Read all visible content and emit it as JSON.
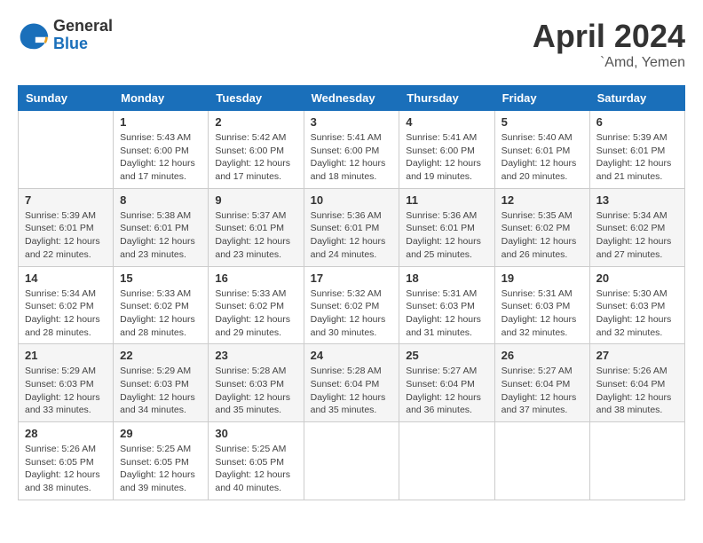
{
  "header": {
    "logo_general": "General",
    "logo_blue": "Blue",
    "month_title": "April 2024",
    "location": "`Amd, Yemen"
  },
  "weekdays": [
    "Sunday",
    "Monday",
    "Tuesday",
    "Wednesday",
    "Thursday",
    "Friday",
    "Saturday"
  ],
  "weeks": [
    [
      {
        "day": "",
        "info": ""
      },
      {
        "day": "1",
        "info": "Sunrise: 5:43 AM\nSunset: 6:00 PM\nDaylight: 12 hours\nand 17 minutes."
      },
      {
        "day": "2",
        "info": "Sunrise: 5:42 AM\nSunset: 6:00 PM\nDaylight: 12 hours\nand 17 minutes."
      },
      {
        "day": "3",
        "info": "Sunrise: 5:41 AM\nSunset: 6:00 PM\nDaylight: 12 hours\nand 18 minutes."
      },
      {
        "day": "4",
        "info": "Sunrise: 5:41 AM\nSunset: 6:00 PM\nDaylight: 12 hours\nand 19 minutes."
      },
      {
        "day": "5",
        "info": "Sunrise: 5:40 AM\nSunset: 6:01 PM\nDaylight: 12 hours\nand 20 minutes."
      },
      {
        "day": "6",
        "info": "Sunrise: 5:39 AM\nSunset: 6:01 PM\nDaylight: 12 hours\nand 21 minutes."
      }
    ],
    [
      {
        "day": "7",
        "info": "Sunrise: 5:39 AM\nSunset: 6:01 PM\nDaylight: 12 hours\nand 22 minutes."
      },
      {
        "day": "8",
        "info": "Sunrise: 5:38 AM\nSunset: 6:01 PM\nDaylight: 12 hours\nand 23 minutes."
      },
      {
        "day": "9",
        "info": "Sunrise: 5:37 AM\nSunset: 6:01 PM\nDaylight: 12 hours\nand 23 minutes."
      },
      {
        "day": "10",
        "info": "Sunrise: 5:36 AM\nSunset: 6:01 PM\nDaylight: 12 hours\nand 24 minutes."
      },
      {
        "day": "11",
        "info": "Sunrise: 5:36 AM\nSunset: 6:01 PM\nDaylight: 12 hours\nand 25 minutes."
      },
      {
        "day": "12",
        "info": "Sunrise: 5:35 AM\nSunset: 6:02 PM\nDaylight: 12 hours\nand 26 minutes."
      },
      {
        "day": "13",
        "info": "Sunrise: 5:34 AM\nSunset: 6:02 PM\nDaylight: 12 hours\nand 27 minutes."
      }
    ],
    [
      {
        "day": "14",
        "info": "Sunrise: 5:34 AM\nSunset: 6:02 PM\nDaylight: 12 hours\nand 28 minutes."
      },
      {
        "day": "15",
        "info": "Sunrise: 5:33 AM\nSunset: 6:02 PM\nDaylight: 12 hours\nand 28 minutes."
      },
      {
        "day": "16",
        "info": "Sunrise: 5:33 AM\nSunset: 6:02 PM\nDaylight: 12 hours\nand 29 minutes."
      },
      {
        "day": "17",
        "info": "Sunrise: 5:32 AM\nSunset: 6:02 PM\nDaylight: 12 hours\nand 30 minutes."
      },
      {
        "day": "18",
        "info": "Sunrise: 5:31 AM\nSunset: 6:03 PM\nDaylight: 12 hours\nand 31 minutes."
      },
      {
        "day": "19",
        "info": "Sunrise: 5:31 AM\nSunset: 6:03 PM\nDaylight: 12 hours\nand 32 minutes."
      },
      {
        "day": "20",
        "info": "Sunrise: 5:30 AM\nSunset: 6:03 PM\nDaylight: 12 hours\nand 32 minutes."
      }
    ],
    [
      {
        "day": "21",
        "info": "Sunrise: 5:29 AM\nSunset: 6:03 PM\nDaylight: 12 hours\nand 33 minutes."
      },
      {
        "day": "22",
        "info": "Sunrise: 5:29 AM\nSunset: 6:03 PM\nDaylight: 12 hours\nand 34 minutes."
      },
      {
        "day": "23",
        "info": "Sunrise: 5:28 AM\nSunset: 6:03 PM\nDaylight: 12 hours\nand 35 minutes."
      },
      {
        "day": "24",
        "info": "Sunrise: 5:28 AM\nSunset: 6:04 PM\nDaylight: 12 hours\nand 35 minutes."
      },
      {
        "day": "25",
        "info": "Sunrise: 5:27 AM\nSunset: 6:04 PM\nDaylight: 12 hours\nand 36 minutes."
      },
      {
        "day": "26",
        "info": "Sunrise: 5:27 AM\nSunset: 6:04 PM\nDaylight: 12 hours\nand 37 minutes."
      },
      {
        "day": "27",
        "info": "Sunrise: 5:26 AM\nSunset: 6:04 PM\nDaylight: 12 hours\nand 38 minutes."
      }
    ],
    [
      {
        "day": "28",
        "info": "Sunrise: 5:26 AM\nSunset: 6:05 PM\nDaylight: 12 hours\nand 38 minutes."
      },
      {
        "day": "29",
        "info": "Sunrise: 5:25 AM\nSunset: 6:05 PM\nDaylight: 12 hours\nand 39 minutes."
      },
      {
        "day": "30",
        "info": "Sunrise: 5:25 AM\nSunset: 6:05 PM\nDaylight: 12 hours\nand 40 minutes."
      },
      {
        "day": "",
        "info": ""
      },
      {
        "day": "",
        "info": ""
      },
      {
        "day": "",
        "info": ""
      },
      {
        "day": "",
        "info": ""
      }
    ]
  ]
}
